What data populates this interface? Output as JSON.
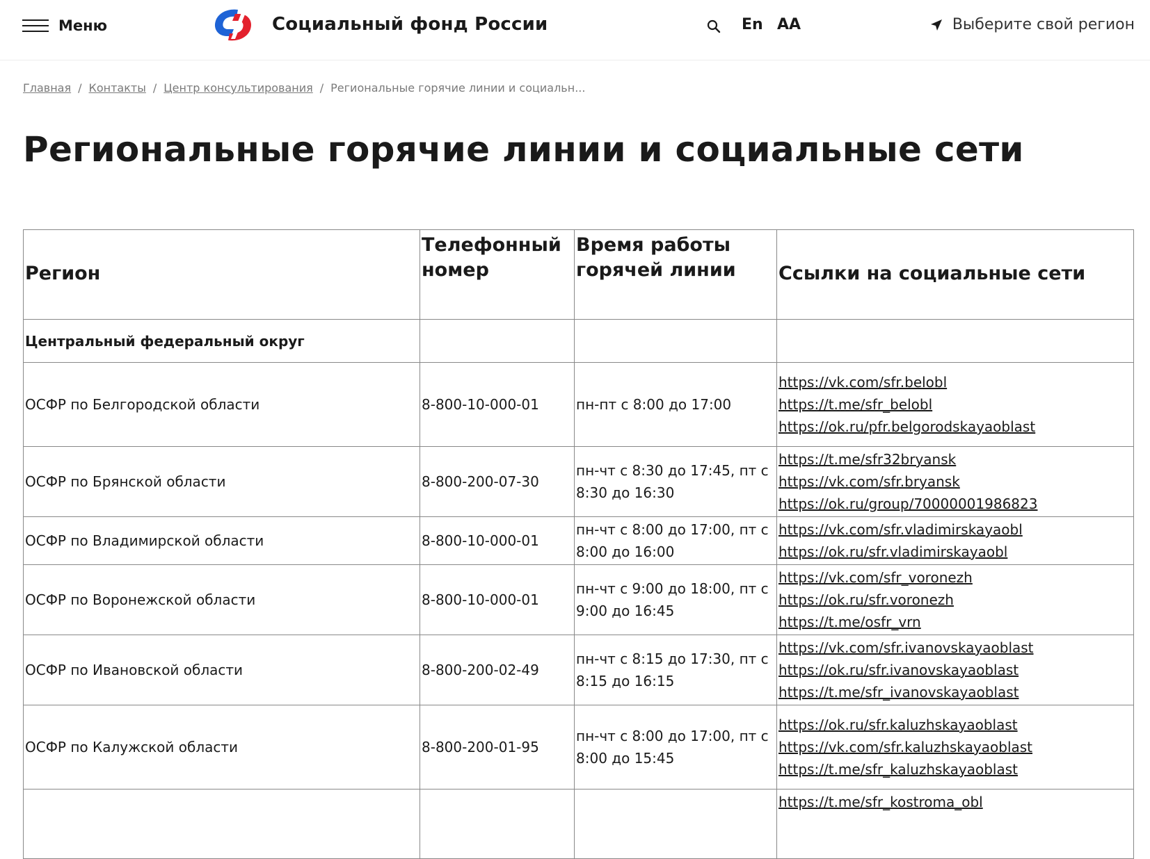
{
  "header": {
    "menu_label": "Меню",
    "site_title": "Социальный фонд России",
    "lang": "En",
    "font_size": "AA",
    "region_label": "Выберите свой регион"
  },
  "colors": {
    "logo_blue": "#1e63d6",
    "logo_red": "#e3212d",
    "text": "#1a1a1a",
    "muted": "#7a7a7a",
    "border": "#888888"
  },
  "icons": {
    "menu": "hamburger-icon",
    "search": "search-icon",
    "region": "location-arrow-icon",
    "logo": "sfr-logo"
  },
  "breadcrumb": {
    "items": [
      "Главная",
      "Контакты",
      "Центр консультирования"
    ],
    "current": "Региональные горячие линии и социальн..."
  },
  "page": {
    "title": "Региональные горячие линии и социальные сети"
  },
  "table": {
    "headers": [
      "Регион",
      "Телефонный номер",
      "Время работы горячей линии",
      "Ссылки на социальные сети"
    ],
    "group": "Центральный федеральный округ",
    "rows": [
      {
        "region": "ОСФР по Белгородской области",
        "phone": "8-800-10-000-01",
        "hours": "пн-пт с 8:00 до 17:00",
        "links": [
          "https://vk.com/sfr.belobl",
          "https://t.me/sfr_belobl",
          "https://ok.ru/pfr.belgorodskayaoblast"
        ]
      },
      {
        "region": "ОСФР по Брянской области",
        "phone": "8-800-200-07-30",
        "hours": "пн-чт с 8:30 до 17:45, пт с 8:30 до 16:30",
        "links": [
          "https://t.me/sfr32bryansk",
          "https://vk.com/sfr.bryansk",
          "https://ok.ru/group/70000001986823"
        ]
      },
      {
        "region": "ОСФР по Владимирской области",
        "phone": "8-800-10-000-01",
        "hours": "пн-чт с 8:00 до 17:00, пт с 8:00 до 16:00",
        "links": [
          "https://vk.com/sfr.vladimirskayaobl",
          "https://ok.ru/sfr.vladimirskayaobl"
        ]
      },
      {
        "region": "ОСФР по Воронежской области",
        "phone": "8-800-10-000-01",
        "hours": "пн-чт с 9:00 до 18:00, пт с 9:00 до 16:45",
        "links": [
          "https://vk.com/sfr_voronezh",
          "https://ok.ru/sfr.voronezh",
          "https://t.me/osfr_vrn"
        ]
      },
      {
        "region": "ОСФР по Ивановской области",
        "phone": "8-800-200-02-49",
        "hours": "пн-чт с 8:15 до 17:30, пт с 8:15 до 16:15",
        "links": [
          "https://vk.com/sfr.ivanovskayaoblast",
          "https://ok.ru/sfr.ivanovskayaoblast",
          "https://t.me/sfr_ivanovskayaoblast"
        ]
      },
      {
        "region": "ОСФР по Калужской области",
        "phone": "8-800-200-01-95",
        "hours": "пн-чт с 8:00 до 17:00, пт с 8:00 до 15:45",
        "links": [
          "https://ok.ru/sfr.kaluzhskayaoblast",
          "https://vk.com/sfr.kaluzhskayaoblast",
          "https://t.me/sfr_kaluzhskayaoblast"
        ]
      },
      {
        "region": "",
        "phone": "",
        "hours": "",
        "links": [
          "https://t.me/sfr_kostroma_obl"
        ]
      }
    ]
  }
}
